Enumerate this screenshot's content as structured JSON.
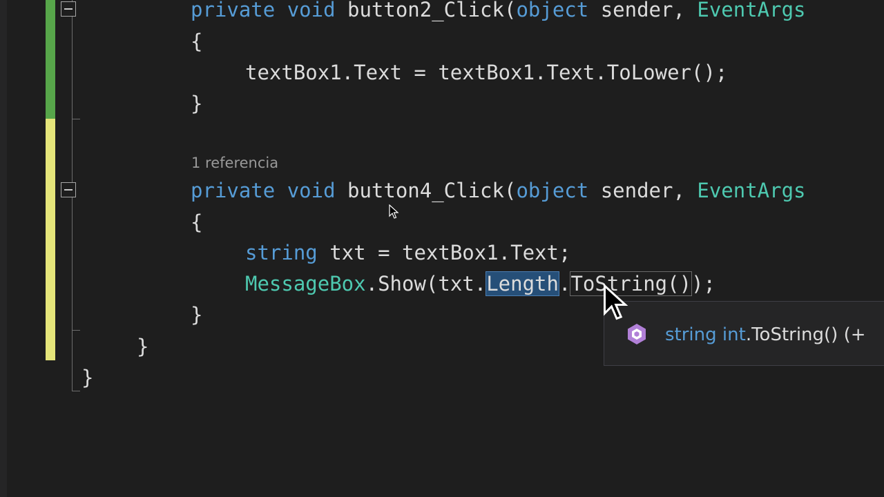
{
  "editor": {
    "codelens_label": "1 referencia",
    "method2": {
      "kw_private": "private",
      "kw_void": "void",
      "name": "button2_Click",
      "open_paren": "(",
      "kw_object": "object",
      "param_sender": "sender,",
      "type_eventargs": "EventArgs",
      "open_brace": "{",
      "body_line": "textBox1.Text = textBox1.Text.ToLower();",
      "close_brace": "}"
    },
    "method4": {
      "kw_private": "private",
      "kw_void": "void",
      "name": "button4_Click",
      "open_paren": "(",
      "kw_object": "object",
      "param_sender": "sender,",
      "type_eventargs": "EventArgs",
      "open_brace": "{",
      "line1_kw_string": "string",
      "line1_rest": "txt = textBox1.Text;",
      "line2_type": "MessageBox",
      "line2_part1": ".Show(txt.",
      "line2_selected": "Length",
      "line2_dot": ".",
      "line2_tostring": "ToString()",
      "line2_end": ");",
      "close_brace": "}"
    },
    "class_close_brace": "}",
    "namespace_close_brace": "}"
  },
  "tooltip": {
    "icon": "method-icon",
    "kw_string": "string",
    "kw_int": "int",
    "signature_rest": ".ToString() (+"
  },
  "colors": {
    "keyword": "#569cd6",
    "type": "#4ec9b0",
    "text": "#dcdcdc",
    "saved_change": "#57a64a",
    "unsaved_change": "#e5e57a",
    "selection": "#264f78"
  }
}
